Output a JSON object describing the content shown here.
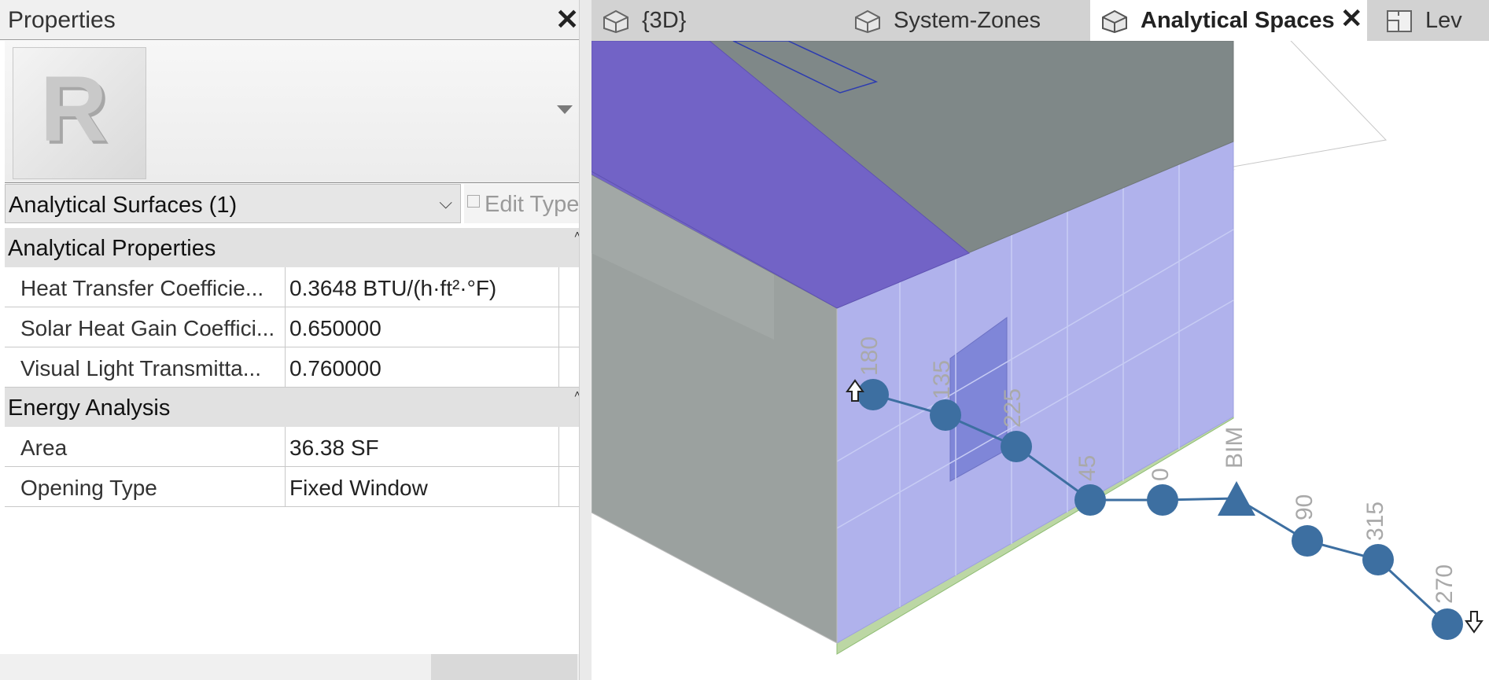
{
  "properties": {
    "title": "Properties",
    "close_icon": "close-icon",
    "type_image": "revit-logo-icon",
    "filter": "Analytical Surfaces (1)",
    "edit_type": "Edit Type",
    "groups": [
      {
        "name": "Analytical Properties",
        "rows": [
          {
            "name": "Heat Transfer Coefficie...",
            "value": "0.3648 BTU/(h·ft²·°F)"
          },
          {
            "name": "Solar Heat Gain Coeffici...",
            "value": "0.650000"
          },
          {
            "name": "Visual Light Transmitta...",
            "value": "0.760000"
          }
        ]
      },
      {
        "name": "Energy Analysis",
        "rows": [
          {
            "name": "Area",
            "value": "36.38 SF"
          },
          {
            "name": "Opening Type",
            "value": "Fixed Window"
          }
        ]
      }
    ]
  },
  "tabs": [
    {
      "label": "{3D}",
      "icon": "3d-view-icon",
      "active": false
    },
    {
      "label": "System-Zones",
      "icon": "3d-view-icon",
      "active": false
    },
    {
      "label": "Analytical Spaces",
      "icon": "3d-view-icon",
      "active": true
    },
    {
      "label": "Lev",
      "icon": "floor-plan-icon",
      "active": false
    }
  ],
  "viewport": {
    "colors": {
      "roof": "#7f8888",
      "wall_dark": "#9ba19f",
      "glazing": "#b0b2ec",
      "highlight": "#7263c6",
      "green_surface": "#bcd7a4",
      "node": "#3d6fa1"
    },
    "node_labels": [
      "180",
      "135",
      "225",
      "45",
      "0",
      "BIM",
      "90",
      "315",
      "270"
    ]
  }
}
